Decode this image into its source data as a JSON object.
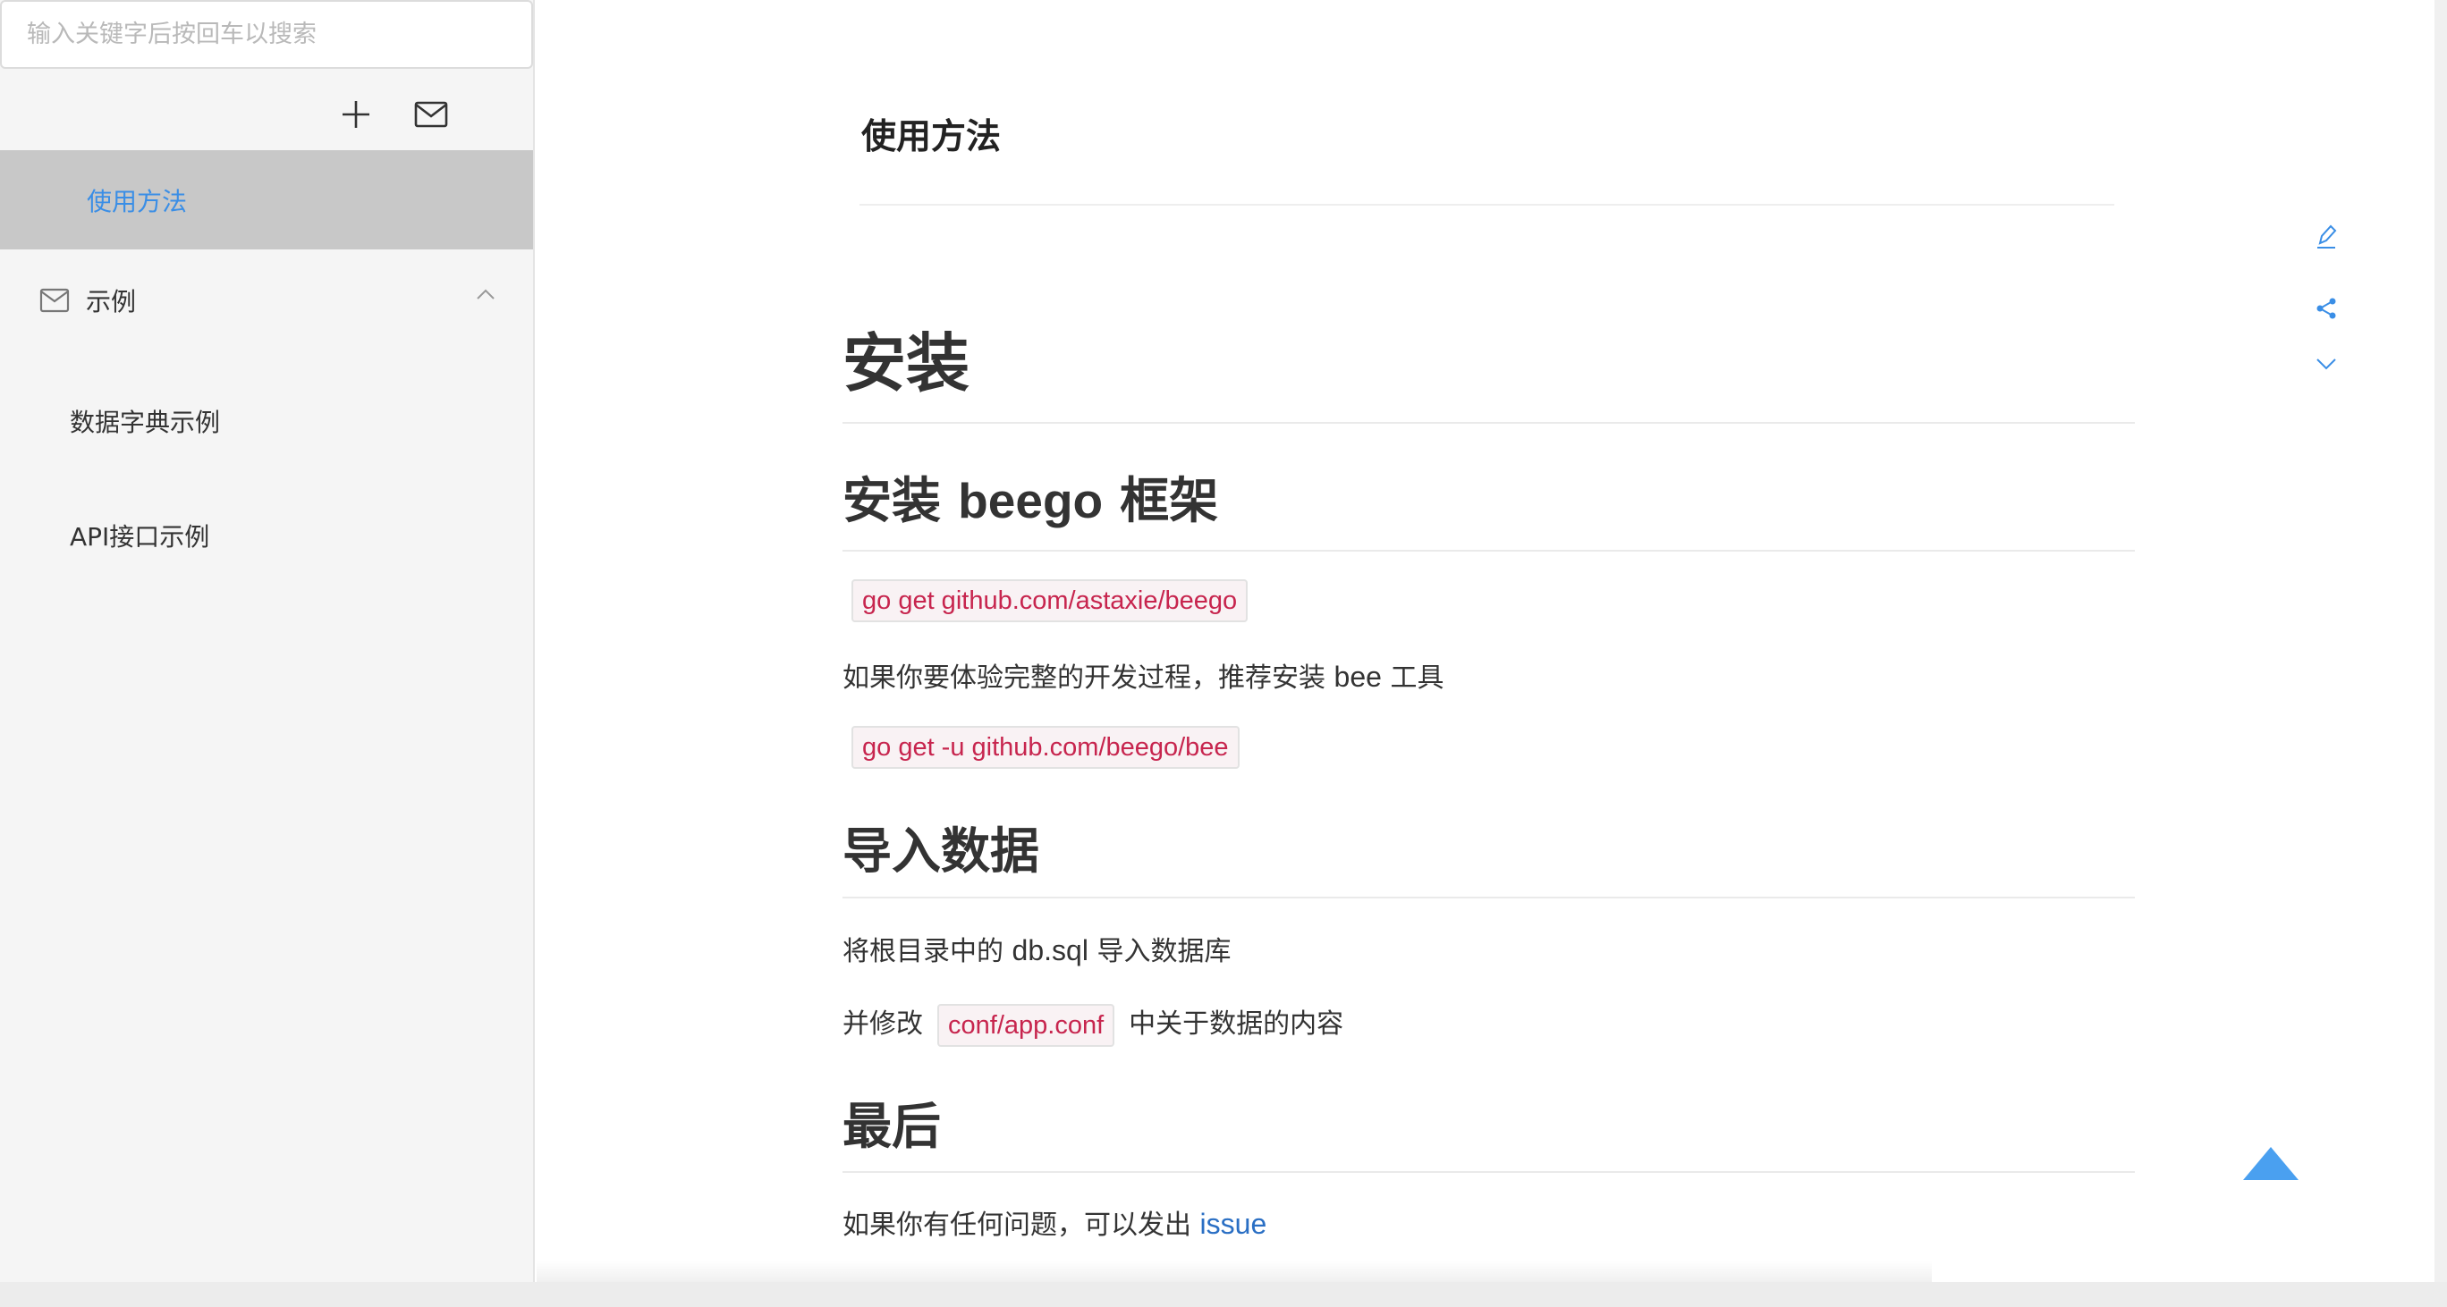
{
  "search": {
    "placeholder": "输入关键字后按回车以搜索"
  },
  "sidebar": {
    "tools": {
      "add_icon": "plus-icon",
      "mail_icon": "mail-icon"
    },
    "active_item": {
      "label": "使用方法"
    },
    "group": {
      "label": "示例",
      "icon": "mail-icon",
      "expanded": true
    },
    "sub_items": [
      {
        "label": "数据字典示例"
      },
      {
        "label": "API接口示例"
      }
    ]
  },
  "document": {
    "title": "使用方法",
    "actions": {
      "edit_icon": "edit-icon",
      "share_icon": "share-icon",
      "more_icon": "chevron-down-icon"
    }
  },
  "article": {
    "h1": "安装",
    "section_install": {
      "heading_pre": "安装",
      "heading_bold": "beego",
      "heading_post": "框架",
      "code1": "go get github.com/astaxie/beego",
      "para_pre": "如果你要体验完整的开发过程，推荐安装",
      "para_word": "bee",
      "para_post": "工具",
      "code2": "go get -u github.com/beego/bee"
    },
    "section_import": {
      "heading": "导入数据",
      "para1_pre": "将根目录中的",
      "para1_word": "db.sql",
      "para1_post": "导入数据库",
      "para2_pre": "并修改",
      "para2_code": "conf/app.conf",
      "para2_post": "中关于数据的内容"
    },
    "section_last": {
      "heading": "最后",
      "para_pre": "如果你有任何问题，可以发出",
      "link": "issue"
    }
  },
  "colors": {
    "accent": "#3a8ee6",
    "code_text": "#c7254e",
    "link": "#2a6fc4",
    "active_bg": "#c8c8c8"
  }
}
